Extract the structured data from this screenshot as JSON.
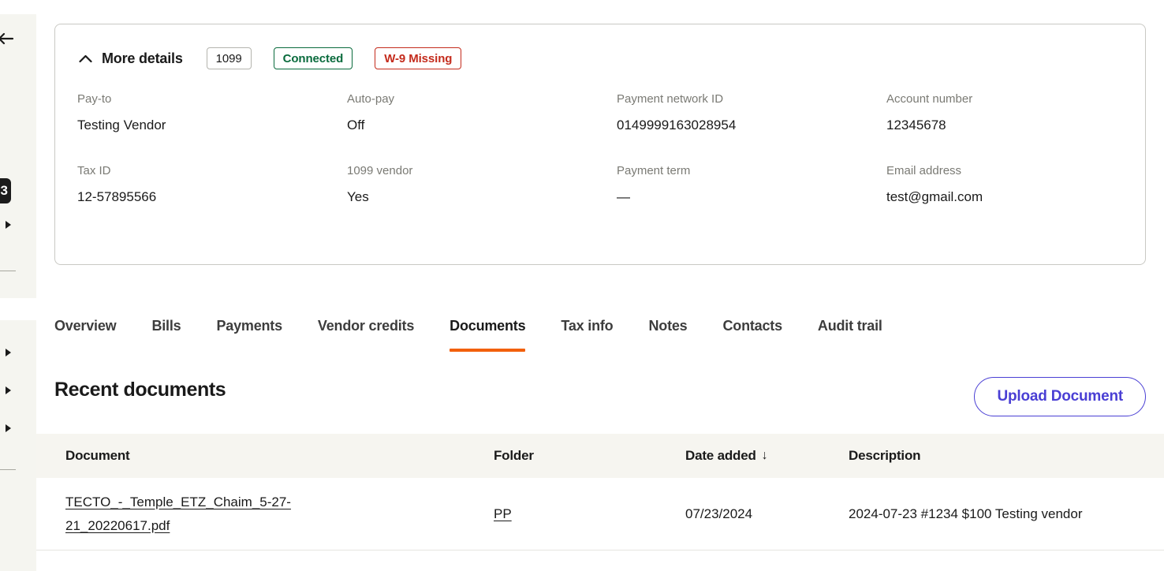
{
  "sidebar": {
    "back_icon": "arrow-left-icon",
    "badge_count": "3",
    "carets": [
      "caret-right-icon",
      "caret-right-icon",
      "caret-right-icon",
      "caret-right-icon"
    ]
  },
  "details_card": {
    "toggle_icon": "chevron-up-icon",
    "title": "More details",
    "badges": [
      {
        "label": "1099",
        "style": "neutral"
      },
      {
        "label": "Connected",
        "style": "success"
      },
      {
        "label": "W-9 Missing",
        "style": "danger"
      }
    ],
    "fields": [
      {
        "label": "Pay-to",
        "value": "Testing Vendor"
      },
      {
        "label": "Auto-pay",
        "value": "Off"
      },
      {
        "label": "Payment network ID",
        "value": "0149999163028954"
      },
      {
        "label": "Account number",
        "value": "12345678"
      },
      {
        "label": "Tax ID",
        "value": "12-57895566"
      },
      {
        "label": "1099 vendor",
        "value": "Yes"
      },
      {
        "label": "Payment term",
        "value": "—"
      },
      {
        "label": "Email address",
        "value": "test@gmail.com"
      }
    ]
  },
  "tabs": [
    {
      "label": "Overview",
      "active": false
    },
    {
      "label": "Bills",
      "active": false
    },
    {
      "label": "Payments",
      "active": false
    },
    {
      "label": "Vendor credits",
      "active": false
    },
    {
      "label": "Documents",
      "active": true
    },
    {
      "label": "Tax info",
      "active": false
    },
    {
      "label": "Notes",
      "active": false
    },
    {
      "label": "Contacts",
      "active": false
    },
    {
      "label": "Audit trail",
      "active": false
    }
  ],
  "section": {
    "title": "Recent documents",
    "upload_button_label": "Upload Document"
  },
  "table": {
    "columns": [
      {
        "label": "Document",
        "sorted": false
      },
      {
        "label": "Folder",
        "sorted": false
      },
      {
        "label": "Date added",
        "sorted": true,
        "sort_icon": "arrow-down-icon",
        "sort_glyph": "↓"
      },
      {
        "label": "Description",
        "sorted": false
      }
    ],
    "rows": [
      {
        "document": "TECTO_-_Temple_ETZ_Chaim_5-27-21_20220617.pdf",
        "folder": "PP",
        "date_added": "07/23/2024",
        "description": "2024-07-23 #1234 $100 Testing vendor"
      }
    ]
  },
  "colors": {
    "accent_tab": "#f2600c",
    "link_purple": "#4a3fd4",
    "success": "#0a6b3d",
    "danger": "#c42b1c",
    "table_header_bg": "#f6f5f0",
    "sidebar_bg": "#f5f5f0"
  }
}
